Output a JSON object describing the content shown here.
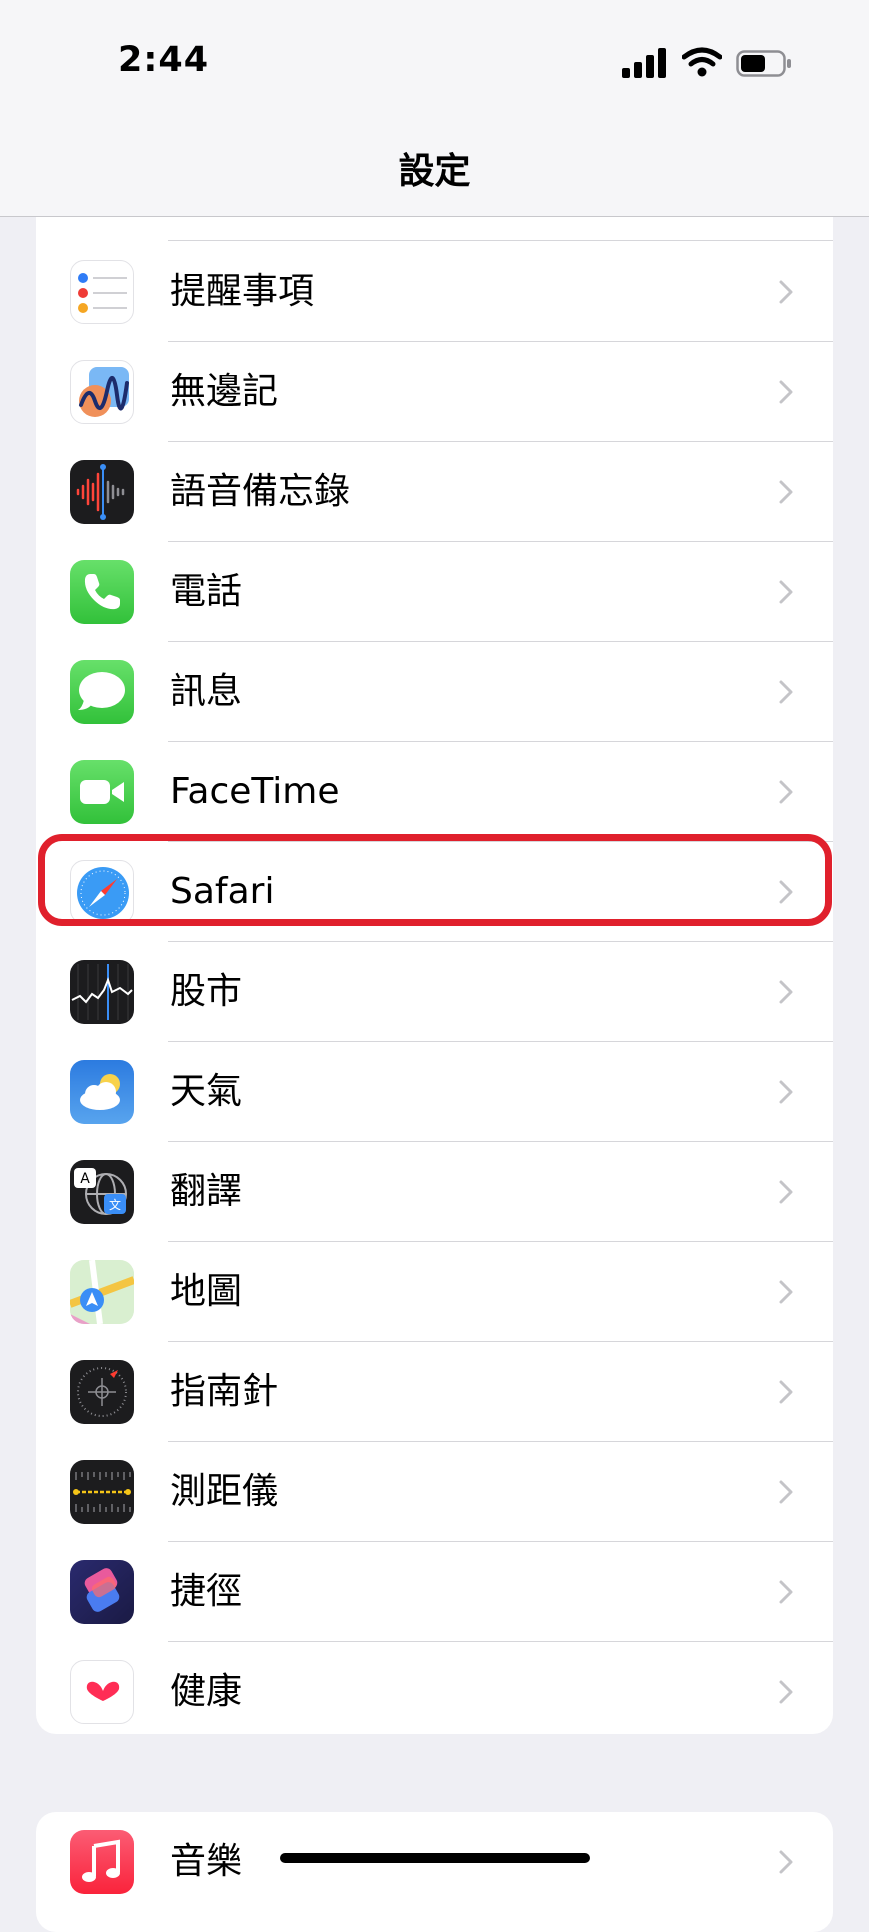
{
  "status_bar": {
    "time": "2:44"
  },
  "nav": {
    "title": "設定"
  },
  "settings_items": [
    {
      "label": "提醒事項",
      "icon": "reminders-icon"
    },
    {
      "label": "無邊記",
      "icon": "freeform-icon"
    },
    {
      "label": "語音備忘錄",
      "icon": "voice-memos-icon"
    },
    {
      "label": "電話",
      "icon": "phone-icon"
    },
    {
      "label": "訊息",
      "icon": "messages-icon"
    },
    {
      "label": "FaceTime",
      "icon": "facetime-icon"
    },
    {
      "label": "Safari",
      "icon": "safari-icon",
      "highlighted": true
    },
    {
      "label": "股市",
      "icon": "stocks-icon"
    },
    {
      "label": "天氣",
      "icon": "weather-icon"
    },
    {
      "label": "翻譯",
      "icon": "translate-icon"
    },
    {
      "label": "地圖",
      "icon": "maps-icon"
    },
    {
      "label": "指南針",
      "icon": "compass-icon"
    },
    {
      "label": "測距儀",
      "icon": "measure-icon"
    },
    {
      "label": "捷徑",
      "icon": "shortcuts-icon"
    },
    {
      "label": "健康",
      "icon": "health-icon"
    }
  ],
  "media_items": [
    {
      "label": "音樂",
      "icon": "music-icon"
    }
  ],
  "colors": {
    "highlight": "#e0202c",
    "background": "#efeff4"
  }
}
